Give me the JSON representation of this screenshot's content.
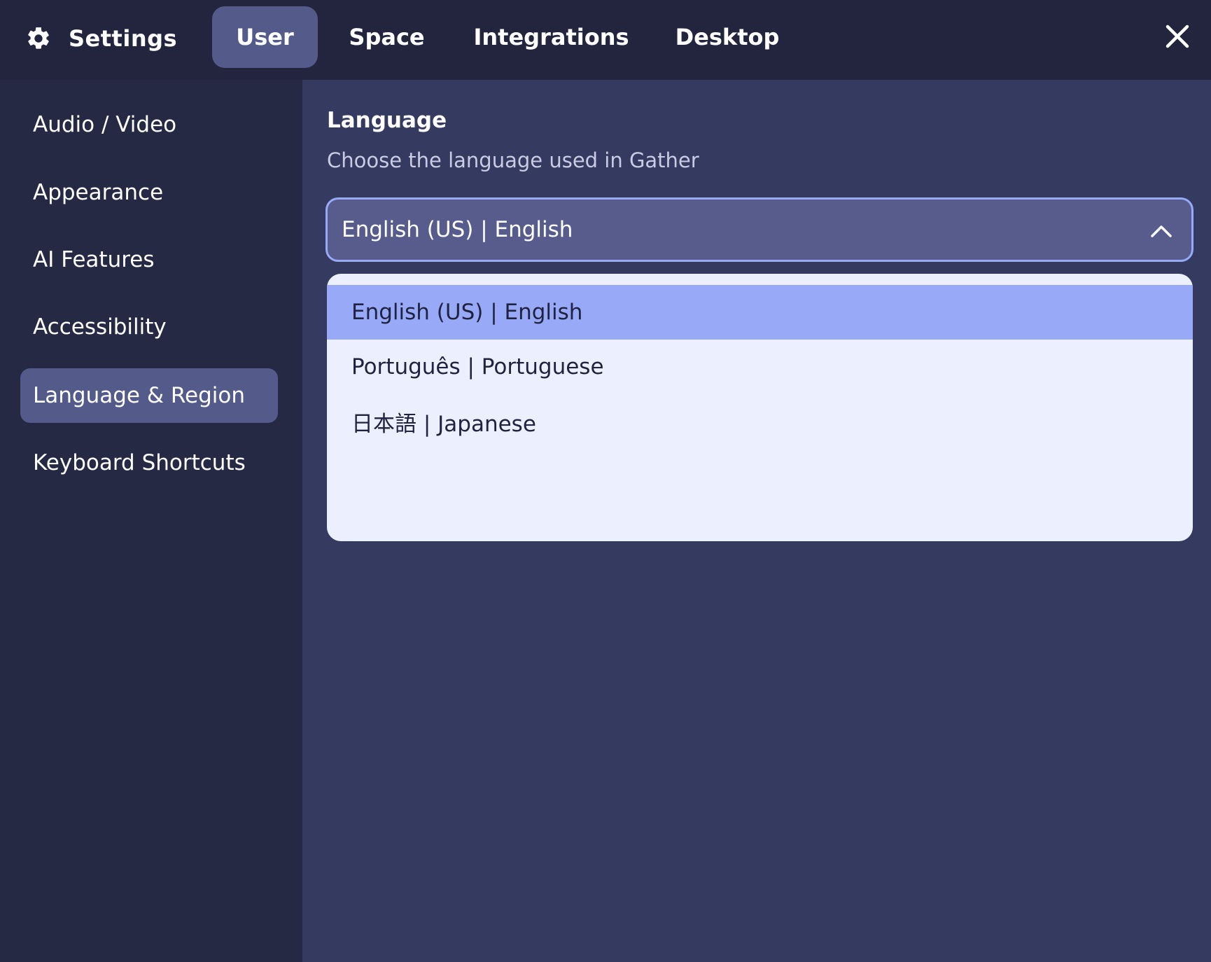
{
  "header": {
    "title": "Settings",
    "tabs": [
      {
        "label": "User",
        "active": true
      },
      {
        "label": "Space",
        "active": false
      },
      {
        "label": "Integrations",
        "active": false
      },
      {
        "label": "Desktop",
        "active": false
      }
    ],
    "icons": {
      "brand": "gear-icon",
      "close": "close-icon"
    }
  },
  "sidebar": {
    "items": [
      {
        "label": "Audio / Video",
        "active": false
      },
      {
        "label": "Appearance",
        "active": false
      },
      {
        "label": "AI Features",
        "active": false
      },
      {
        "label": "Accessibility",
        "active": false
      },
      {
        "label": "Language & Region",
        "active": true
      },
      {
        "label": "Keyboard Shortcuts",
        "active": false
      }
    ]
  },
  "main": {
    "section_title": "Language",
    "section_desc": "Choose the language used in Gather",
    "language_select": {
      "value": "English (US) | English",
      "open": true,
      "options": [
        {
          "label": "English (US) | English",
          "selected": true
        },
        {
          "label": "Português | Portuguese",
          "selected": false
        },
        {
          "label": "日本語 | Japanese",
          "selected": false
        }
      ]
    }
  },
  "colors": {
    "topbar": "#22253d",
    "sidebar": "#252944",
    "main": "#353a60",
    "active_item": "#545a8a",
    "accent": "#98a9f8",
    "dropdown": "#eceffd"
  }
}
